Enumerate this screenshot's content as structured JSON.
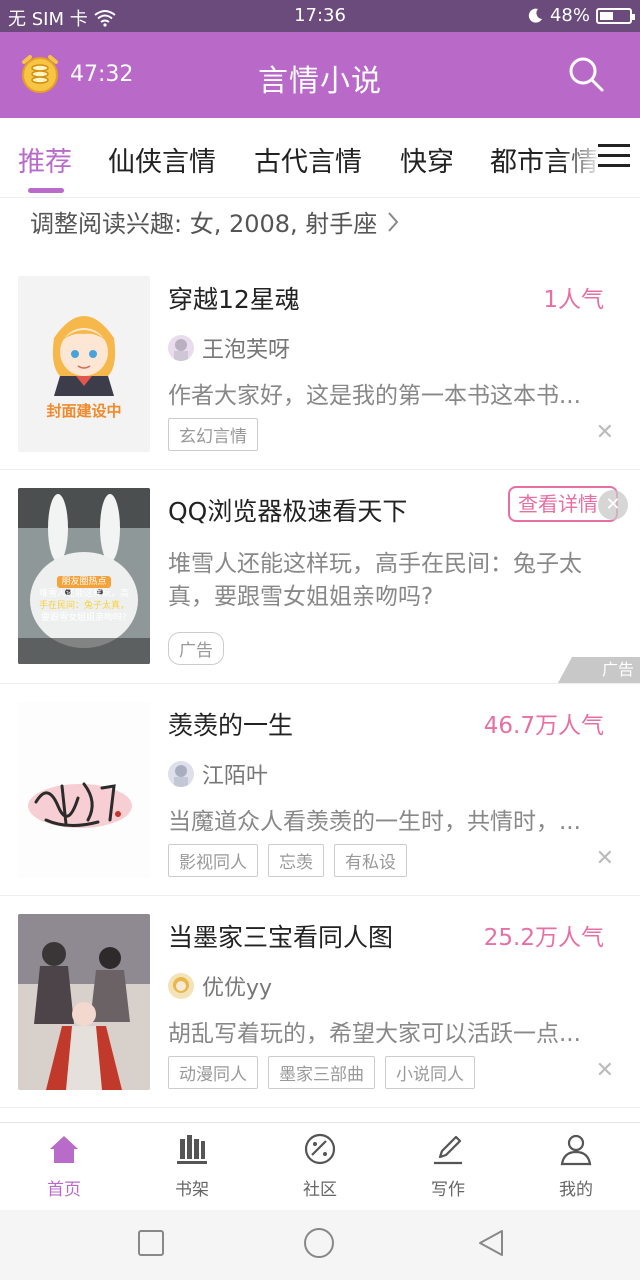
{
  "status_bar": {
    "carrier": "无 SIM 卡",
    "time": "17:36",
    "battery": "48%",
    "battery_level": 0.48
  },
  "header": {
    "timer": "47:32",
    "title": "言情小说"
  },
  "tabs": [
    {
      "label": "推荐",
      "active": true
    },
    {
      "label": "仙侠言情"
    },
    {
      "label": "古代言情"
    },
    {
      "label": "快穿"
    },
    {
      "label": "都市言情"
    }
  ],
  "interest": {
    "text": "调整阅读兴趣: 女, 2008, 射手座"
  },
  "books": [
    {
      "title": "穿越12星魂",
      "popularity": "1人气",
      "author": "王泡芙呀",
      "description": "作者大家好，这是我的第一本书这本书...",
      "tags": [
        "玄幻言情"
      ],
      "cover_text": "封面建设中"
    },
    {
      "title": "羡羡的一生",
      "popularity": "46.7万人气",
      "author": "江陌叶",
      "description": "当魔道众人看羡羡的一生时，共情时，...",
      "tags": [
        "影视同人",
        "忘羡",
        "有私设"
      ]
    },
    {
      "title": "当墨家三宝看同人图",
      "popularity": "25.2万人气",
      "author": "优优yy",
      "description": "胡乱写着玩的，希望大家可以活跃一点...",
      "tags": [
        "动漫同人",
        "墨家三部曲",
        "小说同人"
      ]
    }
  ],
  "ad": {
    "title": "QQ浏览器极速看天下",
    "description": "堆雪人还能这样玩，高手在民间：兔子太真，要跟雪女姐姐亲吻吗?",
    "detail_button": "查看详情",
    "tag": "广告",
    "corner_label": "广告",
    "image_caption_1": "朋友圈热点",
    "image_caption_2": "堆雪人还能这样玩，高",
    "image_caption_3": "手在民间：兔子太真，",
    "image_caption_4": "要跟雪女姐姐亲吻吗?"
  },
  "bottom_nav": [
    {
      "label": "首页",
      "icon": "home-icon",
      "active": true
    },
    {
      "label": "书架",
      "icon": "bookshelf-icon"
    },
    {
      "label": "社区",
      "icon": "community-icon"
    },
    {
      "label": "写作",
      "icon": "write-icon"
    },
    {
      "label": "我的",
      "icon": "profile-icon"
    }
  ],
  "colors": {
    "status_bar": "#6a4b7c",
    "header": "#b96ac9",
    "accent": "#b86bc9",
    "popularity": "#e66fa5"
  }
}
